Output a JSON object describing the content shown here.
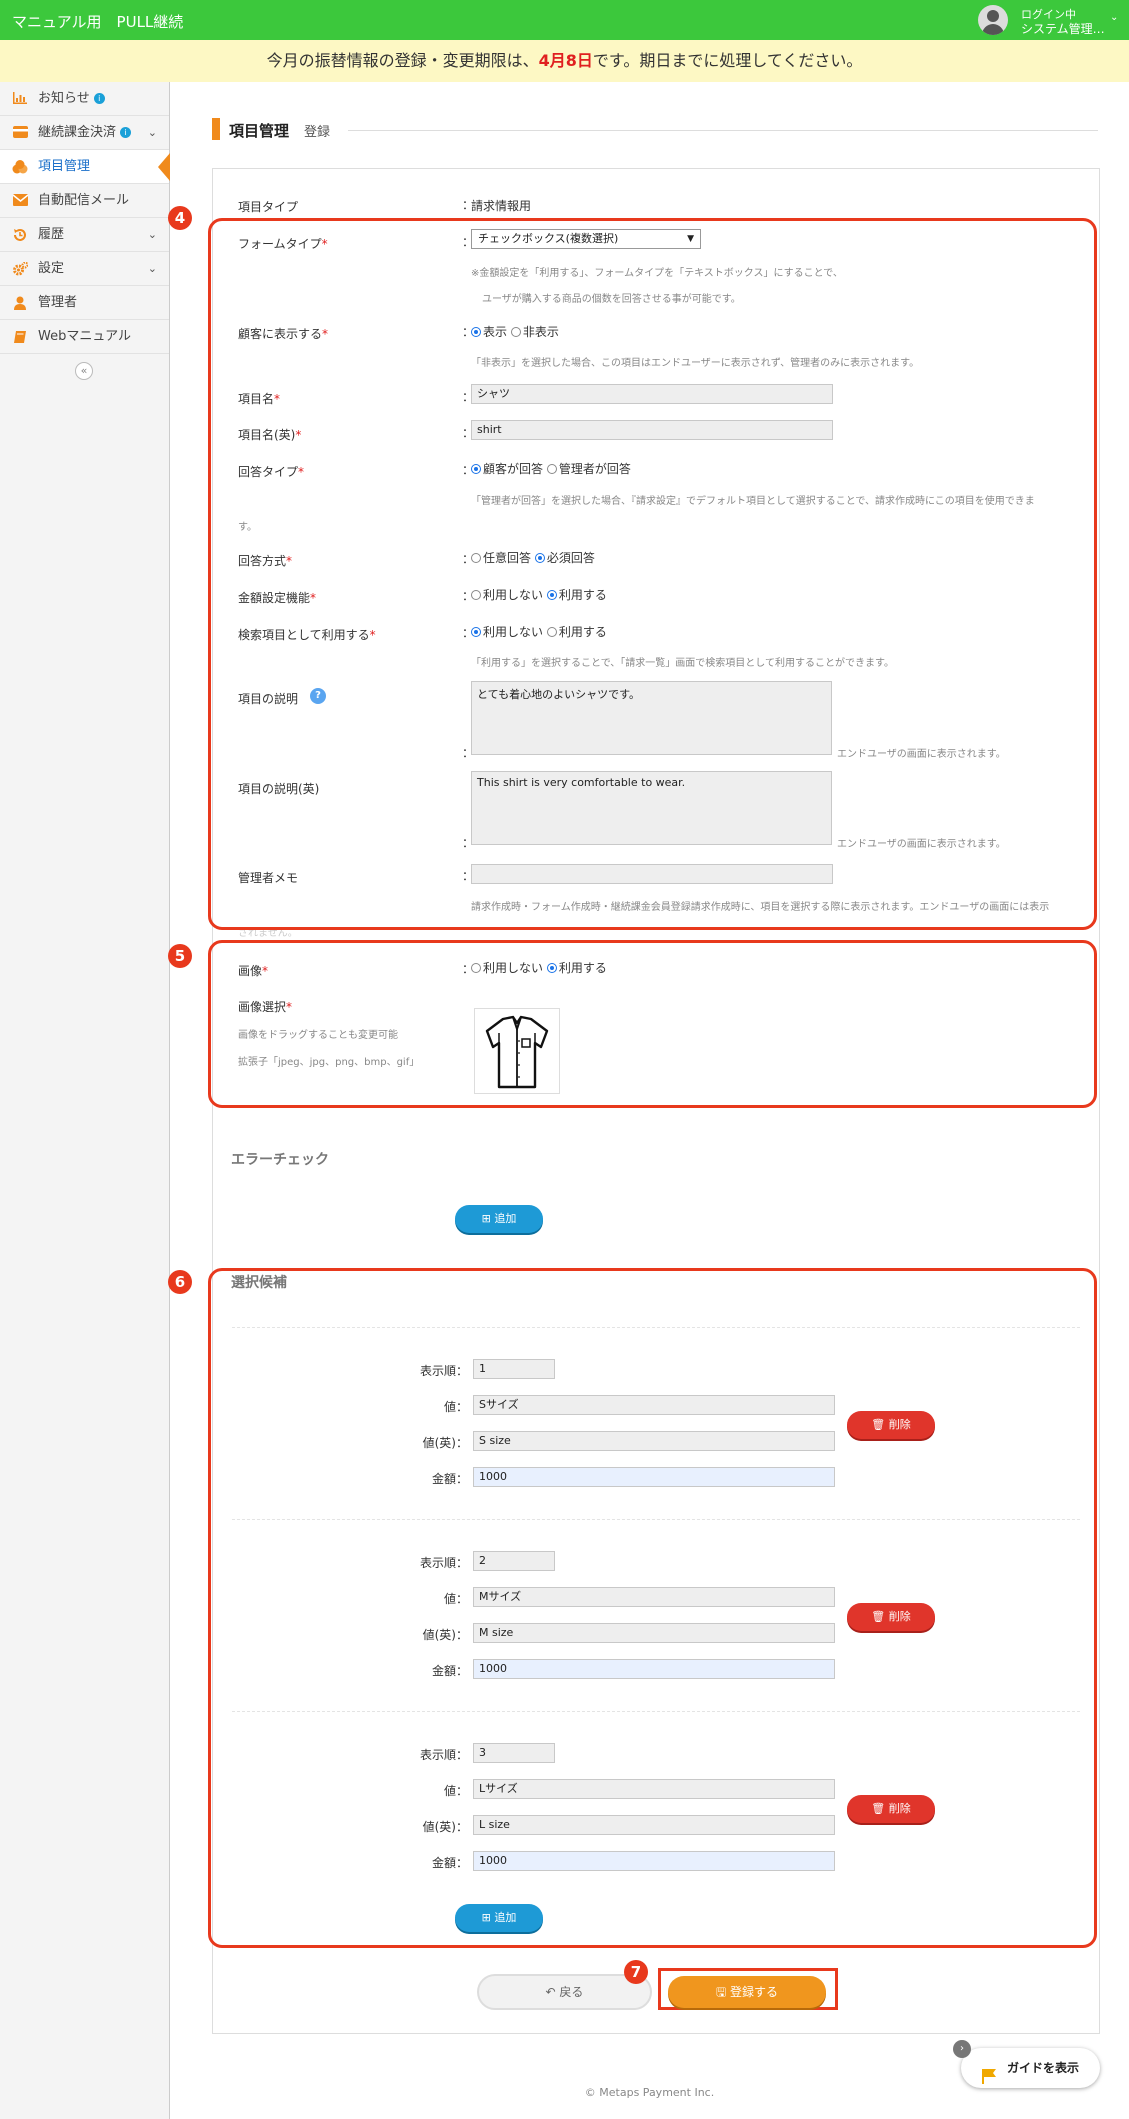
{
  "header": {
    "title": "マニュアル用　PULL継続",
    "login_status": "ログイン中",
    "user_name": "システム管理…",
    "caret": "⌄"
  },
  "notice": {
    "prefix": "今月の振替情報の登録・変更期限は、",
    "deadline": "4月8日",
    "suffix": "です。期日までに処理してください。"
  },
  "sidebar": {
    "items": [
      {
        "label": "お知らせ",
        "icon": "chart-icon"
      },
      {
        "label": "継続課金決済",
        "icon": "card-icon"
      },
      {
        "label": "項目管理",
        "icon": "coins-icon"
      },
      {
        "label": "自動配信メール",
        "icon": "mail-icon"
      },
      {
        "label": "履歴",
        "icon": "history-icon"
      },
      {
        "label": "設定",
        "icon": "gear-icon"
      },
      {
        "label": "管理者",
        "icon": "user-icon"
      },
      {
        "label": "Webマニュアル",
        "icon": "book-icon"
      }
    ],
    "info_glyph": "i",
    "chevron": "⌄",
    "collapse_glyph": "«"
  },
  "section": {
    "title": "項目管理",
    "subtitle": "登録"
  },
  "form": {
    "item_type_label": "項目タイプ",
    "item_type_value": "請求情報用",
    "form_type_label": "フォームタイプ",
    "form_type_value": "チェックボックス(複数選択)",
    "form_type_help1": "※金額設定を「利用する」、フォームタイプを「テキストボックス」にすることで、",
    "form_type_help2": "ユーザが購入する商品の個数を回答させる事が可能です。",
    "display_label": "顧客に表示する",
    "display_on": "表示",
    "display_off": "非表示",
    "display_help": "「非表示」を選択した場合、この項目はエンドユーザーに表示されず、管理者のみに表示されます。",
    "name_label": "項目名",
    "name_value": "シャツ",
    "name_en_label": "項目名(英)",
    "name_en_value": "shirt",
    "answer_type_label": "回答タイプ",
    "answer_type_customer": "顧客が回答",
    "answer_type_admin": "管理者が回答",
    "answer_type_help1": "「管理者が回答」を選択した場合、『請求設定』でデフォルト項目として選択することで、請求作成時にこの項目を使用できま",
    "answer_type_help2": "す。",
    "answer_method_label": "回答方式",
    "answer_optional": "任意回答",
    "answer_required": "必須回答",
    "amount_label": "金額設定機能",
    "no_use": "利用しない",
    "use": "利用する",
    "search_label": "検索項目として利用する",
    "search_help": "「利用する」を選択することで、「請求一覧」画面で検索項目として利用することができます。",
    "desc_label": "項目の説明",
    "desc_value": "とても着心地のよいシャツです。",
    "desc_help": "エンドユーザの画面に表示されます。",
    "desc_en_label": "項目の説明(英)",
    "desc_en_value": "This shirt is very comfortable to wear.",
    "memo_label": "管理者メモ",
    "memo_help": "請求作成時・フォーム作成時・継続課金会員登録請求作成時に、項目を選択する際に表示されます。エンドユーザの画面には表示",
    "memo_help2": "されません。",
    "question_glyph": "?",
    "colon": "：",
    "required_mark": "*"
  },
  "image": {
    "label": "画像",
    "select_label": "画像選択",
    "drag_help": "画像をドラッグすることも変更可能",
    "ext_help": "拡張子「jpeg、jpg、png、bmp、gif」"
  },
  "error_check": {
    "title": "エラーチェック",
    "add_label": "追加"
  },
  "choices": {
    "title": "選択候補",
    "order_label": "表示順：",
    "value_label": "値：",
    "value_en_label": "値(英)：",
    "amount_label": "金額：",
    "delete_label": "削除",
    "add_label": "追加",
    "items": [
      {
        "order": "1",
        "value": "Sサイズ",
        "value_en": "S size",
        "amount": "1000"
      },
      {
        "order": "2",
        "value": "Mサイズ",
        "value_en": "M size",
        "amount": "1000"
      },
      {
        "order": "3",
        "value": "Lサイズ",
        "value_en": "L size",
        "amount": "1000"
      }
    ]
  },
  "actions": {
    "back_label": "戻る",
    "save_label": "登録する"
  },
  "badges": [
    "4",
    "5",
    "6",
    "7"
  ],
  "guide": {
    "label": "ガイドを表示",
    "close_glyph": "›"
  },
  "footer": {
    "copyright": "© Metaps Payment Inc."
  },
  "colors": {
    "header_green": "#3cc83c",
    "accent_orange": "#f08a1c",
    "highlight_red": "#e8391d",
    "button_blue": "#1e9ad6",
    "delete_red": "#e0352b"
  }
}
